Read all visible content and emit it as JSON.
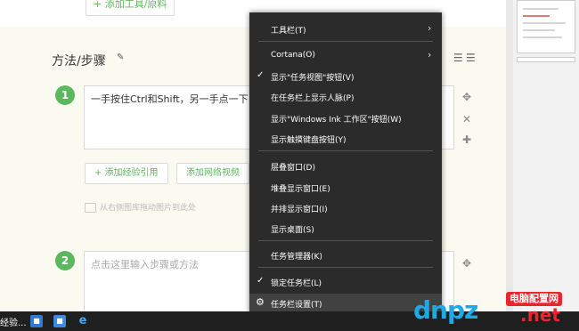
{
  "page": {
    "add_tool_label": "+ 添加工具/原料",
    "section_title": "方法/步骤",
    "steps": [
      {
        "number": "1",
        "text": "一手按住Ctrl和Shift，另一手点一下"
      },
      {
        "number": "2",
        "placeholder": "点击这里输入步骤或方法"
      }
    ],
    "add_experience_label": "+ 添加经验引用",
    "add_web_video_label": "添加网络视频",
    "image_hint": "从右侧图库拖动图片到此处"
  },
  "context_menu": {
    "items": [
      {
        "label": "工具栏(T)",
        "submenu": true
      },
      {
        "label": "Cortana(O)",
        "submenu": true
      },
      {
        "label": "显示\"任务视图\"按钮(V)",
        "checked": true
      },
      {
        "label": "在任务栏上显示人脉(P)"
      },
      {
        "label": "显示\"Windows Ink 工作区\"按钮(W)"
      },
      {
        "label": "显示触摸键盘按钮(Y)"
      },
      {
        "label": "层叠窗口(D)"
      },
      {
        "label": "堆叠显示窗口(E)"
      },
      {
        "label": "并排显示窗口(I)"
      },
      {
        "label": "显示桌面(S)"
      },
      {
        "label": "任务管理器(K)"
      },
      {
        "label": "锁定任务栏(L)",
        "checked": true
      },
      {
        "label": "任务栏设置(T)",
        "icon": "gear-icon",
        "highlighted": true
      }
    ]
  },
  "taskbar": {
    "left_label": "经验...",
    "icons": [
      "app-icon",
      "app-icon",
      "internet-explorer-icon"
    ]
  },
  "watermark": {
    "brand_text": "dnpz",
    "badge": "电脑配置网",
    "domain": ".net"
  },
  "colors": {
    "accent_green": "#5cb85c",
    "menu_bg": "#2b2b2b",
    "menu_highlight": "#414141",
    "taskbar_bg": "#1f1f1f",
    "watermark_blue": "#1da8e6",
    "watermark_red": "#e8262d"
  }
}
